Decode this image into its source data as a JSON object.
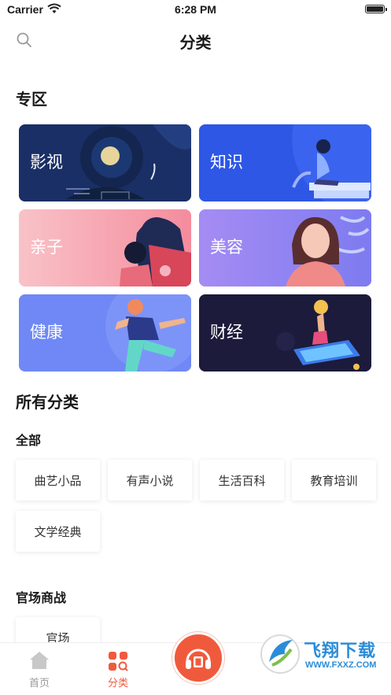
{
  "status": {
    "carrier": "Carrier",
    "time": "6:28 PM"
  },
  "nav": {
    "title": "分类"
  },
  "zone": {
    "title": "专区",
    "cards": [
      {
        "label": "影视",
        "color": "#1a2f66"
      },
      {
        "label": "知识",
        "color": "#2e57e6"
      },
      {
        "label": "亲子",
        "color": "#f7a7b0"
      },
      {
        "label": "美容",
        "color": "#9a7cf0"
      },
      {
        "label": "健康",
        "color": "#6f88f5"
      },
      {
        "label": "财经",
        "color": "#1c1b3c"
      }
    ]
  },
  "all": {
    "title": "所有分类",
    "groups": [
      {
        "title": "全部",
        "items": [
          "曲艺小品",
          "有声小说",
          "生活百科",
          "教育培训",
          "文学经典"
        ]
      },
      {
        "title": "官场商战",
        "items": [
          "官场"
        ]
      }
    ]
  },
  "tabbar": {
    "tabs": [
      {
        "label": "首页",
        "icon": "home-icon"
      },
      {
        "label": "分类",
        "icon": "category-icon"
      }
    ],
    "center_icon": "headphones-icon",
    "accent": "#f05a3c"
  },
  "watermark": {
    "text": "飞翔下载",
    "url": "WWW.FXXZ.COM"
  }
}
